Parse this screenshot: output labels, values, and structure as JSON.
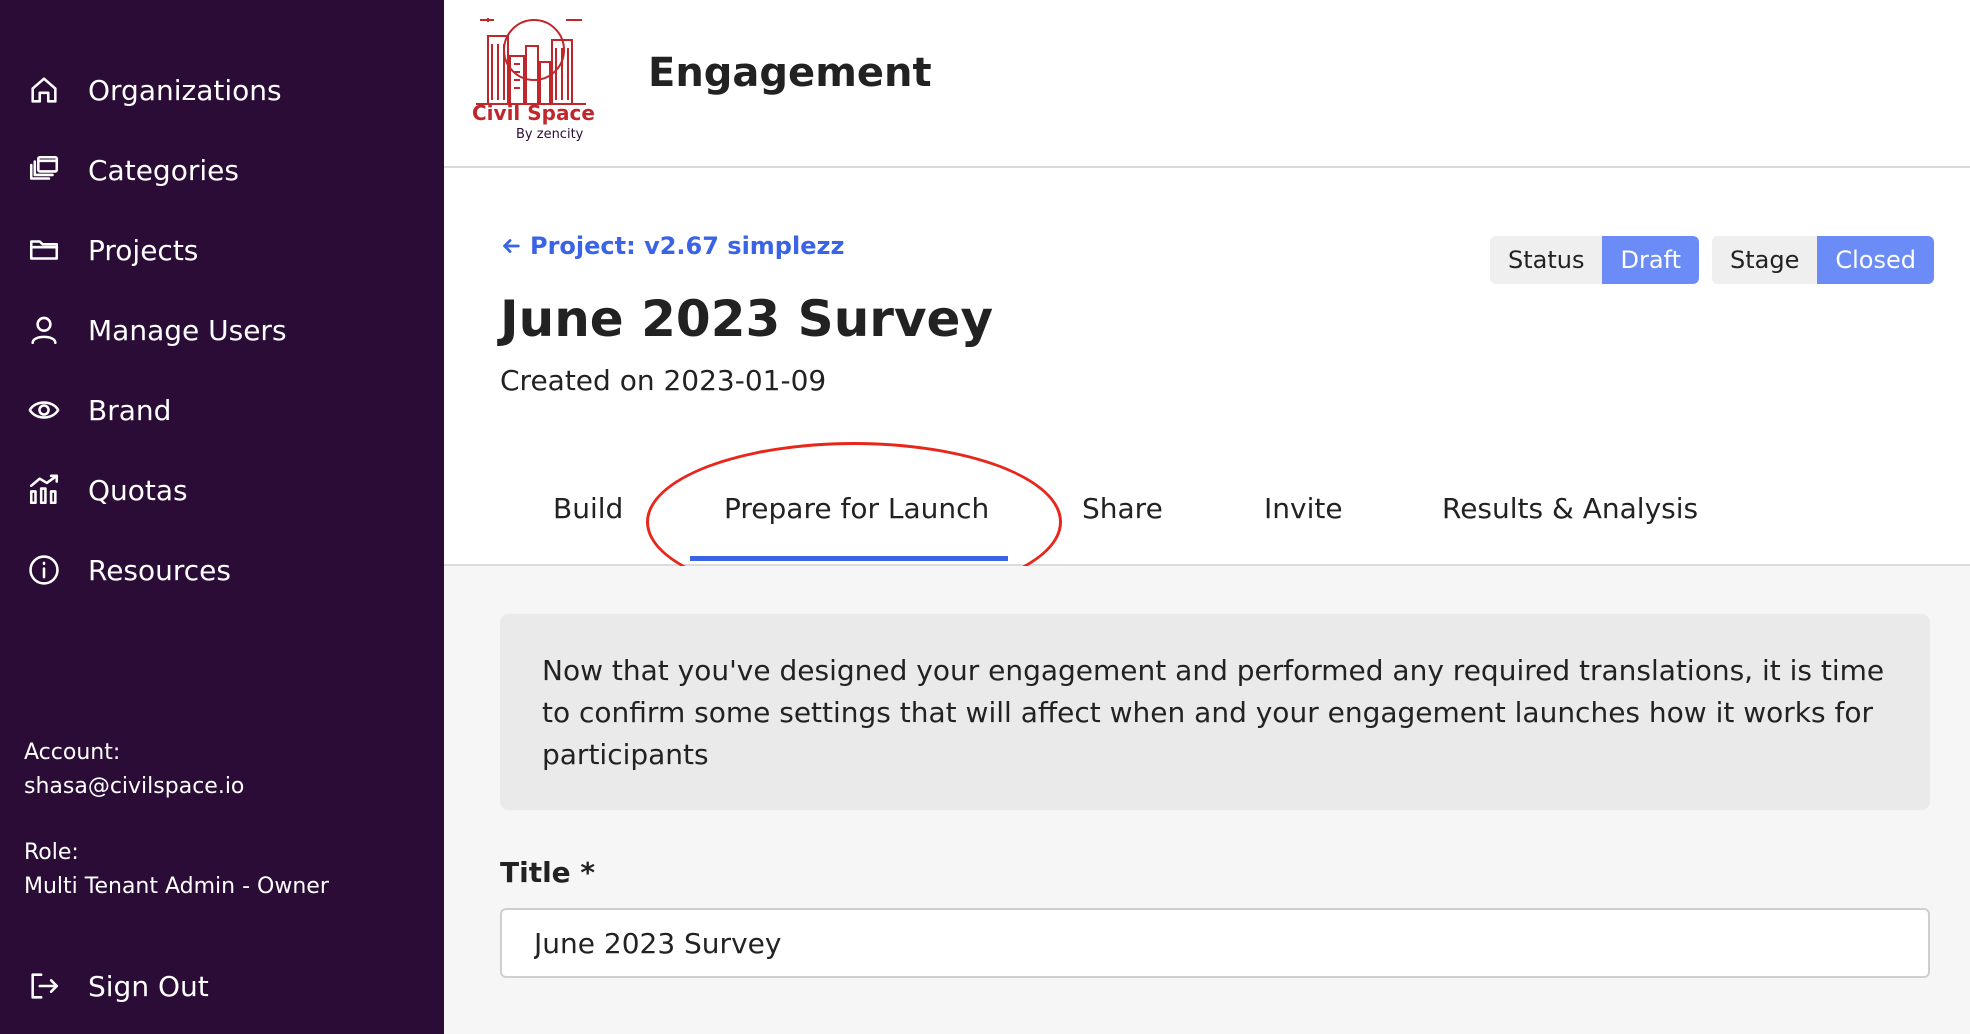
{
  "sidebar": {
    "items": [
      {
        "label": "Organizations",
        "icon": "home-icon"
      },
      {
        "label": "Categories",
        "icon": "stacked-windows-icon"
      },
      {
        "label": "Projects",
        "icon": "folder-icon"
      },
      {
        "label": "Manage Users",
        "icon": "user-icon"
      },
      {
        "label": "Brand",
        "icon": "eye-icon"
      },
      {
        "label": "Quotas",
        "icon": "bar-chart-icon"
      },
      {
        "label": "Resources",
        "icon": "info-icon"
      }
    ],
    "account_label": "Account:",
    "account_value": "shasa@civilspace.io",
    "role_label": "Role:",
    "role_value": "Multi Tenant Admin - Owner",
    "sign_out": "Sign Out"
  },
  "header": {
    "logo_text": "Civil Space",
    "logo_sub": "By zencity",
    "title": "Engagement"
  },
  "project": {
    "back_link": "Project: v2.67 simplezz",
    "title": "June 2023 Survey",
    "created": "Created on 2023-01-09",
    "status_label": "Status",
    "status_value": "Draft",
    "stage_label": "Stage",
    "stage_value": "Closed"
  },
  "tabs": [
    {
      "label": "Build"
    },
    {
      "label": "Prepare for Launch",
      "active": true
    },
    {
      "label": "Share"
    },
    {
      "label": "Invite"
    },
    {
      "label": "Results & Analysis"
    }
  ],
  "content": {
    "info_text": "Now that you've designed your engagement and performed any required translations, it is time to confirm some settings that will affect when and your engagement launches how it works for participants",
    "title_label": "Title *",
    "title_value": "June 2023 Survey"
  },
  "colors": {
    "sidebar_bg": "#2a0c36",
    "accent": "#3a63e6",
    "pill_value": "#6b8cf7",
    "annotation": "#e8261b",
    "logo": "#c0272d"
  }
}
